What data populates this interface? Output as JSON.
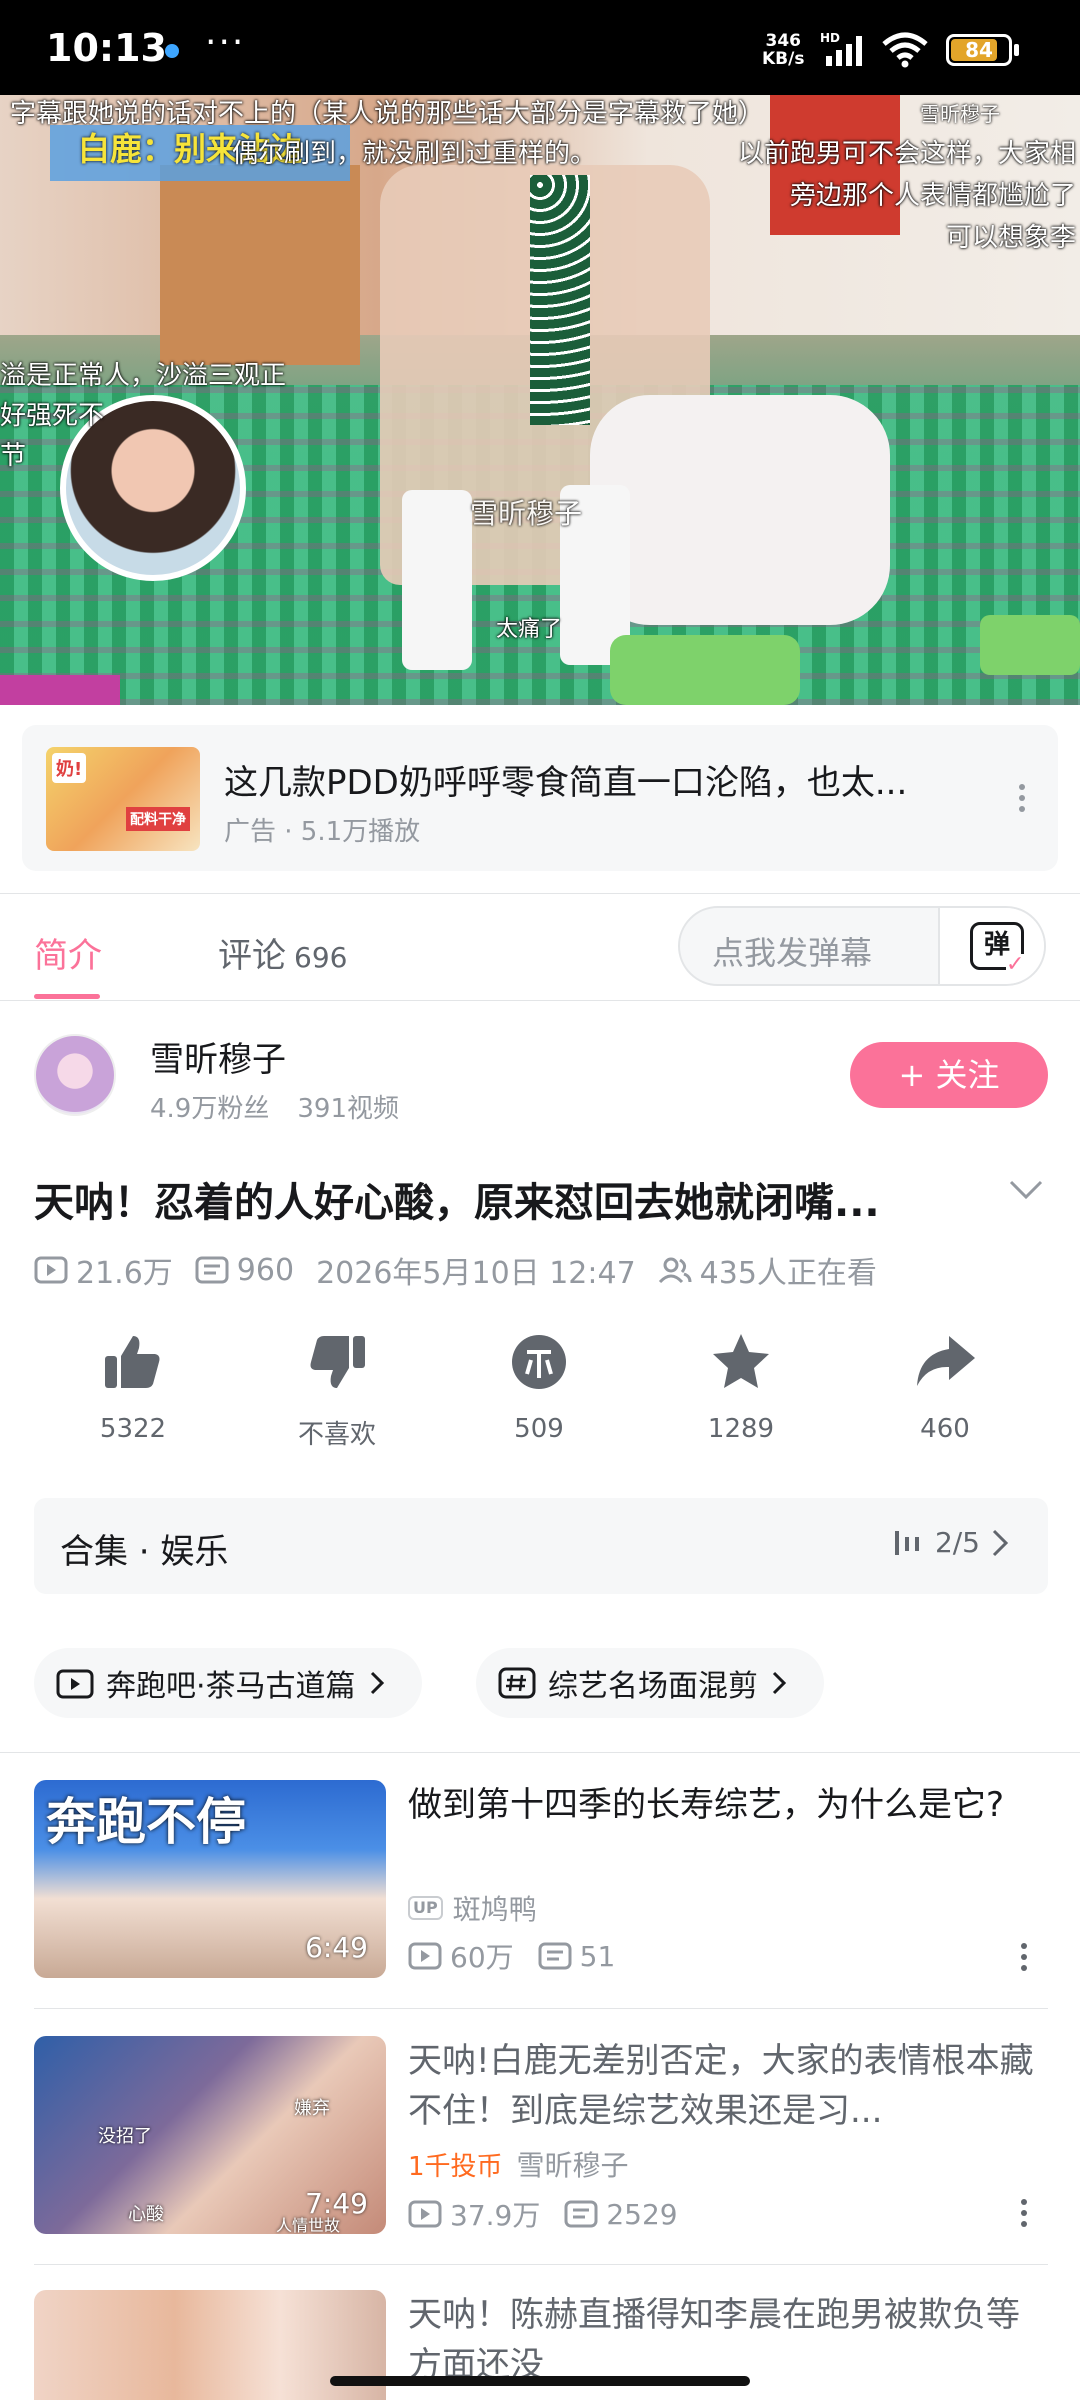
{
  "status_bar": {
    "time": "10:13",
    "more": "···",
    "speed_value": "346",
    "speed_unit": "KB/s",
    "network": "HD",
    "battery": "84",
    "battery_level": 0.84
  },
  "video": {
    "captions": {
      "top": "字幕跟她说的话对不上的（某人说的那些话大部分是字幕救了她）",
      "speaker": "白鹿：别来沾边",
      "mid": "偶尔刷到，就没刷到过重样的。",
      "watermark_top": "雪昕穆子",
      "right1": "以前跑男可不会这样，大家相",
      "right2": "旁边那个人表情都尴尬了",
      "right3": "可以想象李",
      "left1": "溢是正常人，沙溢三观正",
      "left2": "好强死不",
      "left3": "节",
      "watermark_center": "雪昕穆子",
      "bottom": "太痛了"
    }
  },
  "ad": {
    "title": "这几款PDD奶呼呼零食简直一口沦陷，也太...",
    "subtitle": "广告 · 5.1万播放",
    "thumb_tag": "奶!",
    "thumb_tag2": "配料干净"
  },
  "tabs": {
    "intro": "简介",
    "comments": "评论",
    "comments_count": "696",
    "danmaku_placeholder": "点我发弹幕",
    "danmaku_icon": "弹"
  },
  "uploader": {
    "name": "雪昕穆子",
    "fans": "4.9万粉丝",
    "videos": "391视频",
    "follow_label": "+ 关注"
  },
  "video_info": {
    "title": "天呐！忍着的人好心酸，原来怼回去她就闭嘴...",
    "plays": "21.6万",
    "danmaku_count": "960",
    "date": "2026年5月10日 12:47",
    "watching": "435人正在看"
  },
  "actions": {
    "like": "5322",
    "dislike": "不喜欢",
    "coin": "509",
    "favorite": "1289",
    "share": "460"
  },
  "collection": {
    "title": "合集 · 娱乐",
    "progress": "2/5"
  },
  "tags": [
    "奔跑吧·茶马古道篇",
    "综艺名场面混剪"
  ],
  "related": [
    {
      "title": "做到第十四季的长寿综艺，为什么是它?",
      "up_tag": "UP",
      "uploader": "斑鸠鸭",
      "plays": "60万",
      "danmaku": "51",
      "duration": "6:49",
      "thumb_text": "奔跑不停"
    },
    {
      "title": "天呐!白鹿无差别否定，大家的表情根本藏不住！到底是综艺效果还是习...",
      "coin_tag": "1千投币",
      "uploader": "雪昕穆子",
      "plays": "37.9万",
      "danmaku": "2529",
      "duration": "7:49",
      "thumb_labels": [
        "没招了",
        "嫌弃",
        "心酸",
        "人情世故"
      ]
    },
    {
      "title": "天呐！陈赫直播得知李晨在跑男被欺负等方面还没"
    }
  ],
  "colors": {
    "accent": "#fb7299",
    "text_secondary": "#9499a0",
    "coin_orange": "#ff6a1f"
  }
}
